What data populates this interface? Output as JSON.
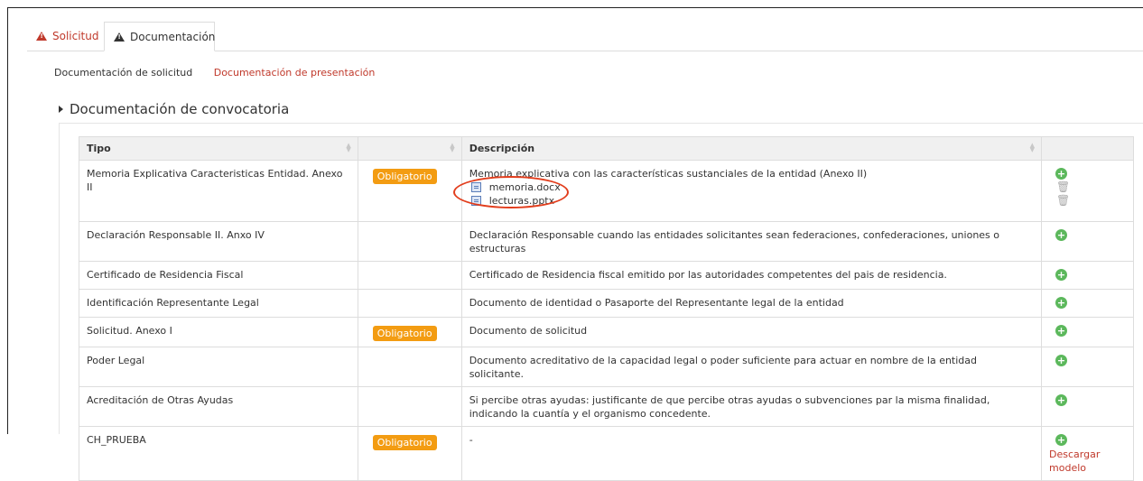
{
  "tabs": [
    {
      "label": "Solicitud",
      "icon": "warning-icon"
    },
    {
      "label": "Documentación",
      "icon": "warning-icon"
    }
  ],
  "subnav": {
    "active": "Documentación de solicitud",
    "link": "Documentación de presentación"
  },
  "section": {
    "title": "Documentación de convocatoria"
  },
  "table": {
    "headers": {
      "tipo": "Tipo",
      "estado": "",
      "descripcion": "Descripción",
      "acciones": ""
    },
    "rows": [
      {
        "tipo": "Memoria Explicativa Caracteristicas Entidad. Anexo II",
        "badge": "Obligatorio",
        "descripcion": "Memoria explicativa con las características sustanciales de la entidad (Anexo II)",
        "files": [
          "memoria.docx",
          "lecturas.pptx"
        ]
      },
      {
        "tipo": "Declaración Responsable II. Anxo IV",
        "badge": "",
        "descripcion": "Declaración Responsable cuando las entidades solicitantes sean federaciones, confederaciones, uniones o estructuras"
      },
      {
        "tipo": "Certificado de Residencia Fiscal",
        "badge": "",
        "descripcion": "Certificado de Residencia fiscal emitido por las autoridades competentes del pais de residencia."
      },
      {
        "tipo": "Identificación Representante Legal",
        "badge": "",
        "descripcion": "Documento de identidad o Pasaporte del Representante legal de la entidad"
      },
      {
        "tipo": "Solicitud. Anexo I",
        "badge": "Obligatorio",
        "descripcion": "Documento de solicitud"
      },
      {
        "tipo": "Poder Legal",
        "badge": "",
        "descripcion": "Documento acreditativo de la capacidad legal o poder suficiente para actuar en nombre de la entidad solicitante."
      },
      {
        "tipo": "Acreditación de Otras Ayudas",
        "badge": "",
        "descripcion": "Si percibe otras ayudas: justificante de que percibe otras ayudas o subvenciones par la misma finalidad, indicando la cuantía y el organismo concedente."
      },
      {
        "tipo": "CH_PRUEBA",
        "badge": "Obligatorio",
        "descripcion": "-",
        "link": "Descargar modelo"
      }
    ]
  },
  "colors": {
    "accent": "#c0392b",
    "badge": "#f39c12",
    "add": "#5cb85c",
    "annotation": "#e23d1c"
  }
}
